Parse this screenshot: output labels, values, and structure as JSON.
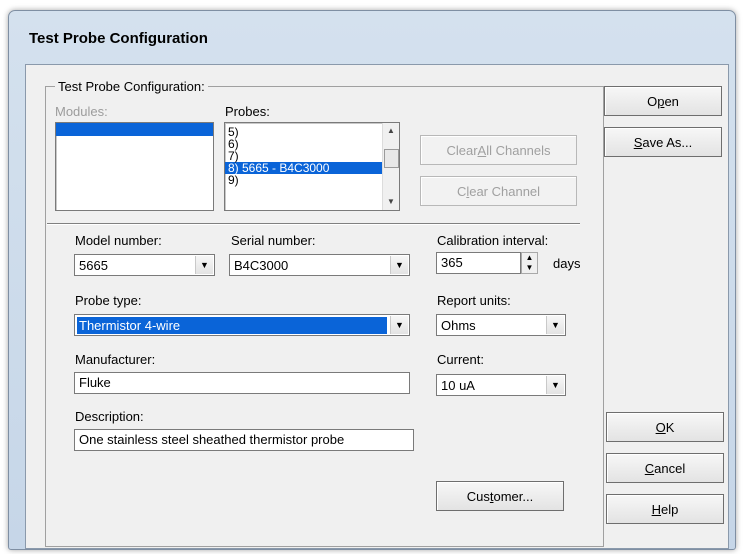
{
  "window": {
    "title": "Test Probe Configuration"
  },
  "group": {
    "label": "Test Probe Configuration:"
  },
  "modules": {
    "label": "Modules:"
  },
  "probes": {
    "label": "Probes:",
    "items": [
      "5)",
      "6)",
      "7)",
      "8) 5665 - B4C3000",
      "9)"
    ],
    "selected_index": 3
  },
  "buttons": {
    "clear_all_pre": "Clear ",
    "clear_all_u": "A",
    "clear_all_post": "ll Channels",
    "clear_channel_pre": "C",
    "clear_channel_u": "l",
    "clear_channel_post": "ear Channel",
    "open_pre": "O",
    "open_u": "p",
    "open_post": "en",
    "save_u": "S",
    "save_post": "ave As...",
    "ok_u": "O",
    "ok_post": "K",
    "cancel_u": "C",
    "cancel_post": "ancel",
    "help_u": "H",
    "help_post": "elp",
    "customer_pre": "Cus",
    "customer_u": "t",
    "customer_post": "omer..."
  },
  "model": {
    "label": "Model number:",
    "value": "5665"
  },
  "serial": {
    "label": "Serial number:",
    "value": "B4C3000"
  },
  "calibration": {
    "label": "Calibration interval:",
    "value": "365",
    "unit": "days"
  },
  "probe_type": {
    "label": "Probe type:",
    "value": "Thermistor 4-wire"
  },
  "report_units": {
    "label": "Report units:",
    "value": "Ohms"
  },
  "manufacturer": {
    "label": "Manufacturer:",
    "value": "Fluke"
  },
  "current": {
    "label": "Current:",
    "value": "10 uA"
  },
  "description": {
    "label": "Description:",
    "value": "One stainless steel sheathed thermistor probe"
  },
  "colors": {
    "selection": "#0a64d8",
    "dialog_bg": "#f0f0f0",
    "title_bg": "#c6d6e8"
  }
}
